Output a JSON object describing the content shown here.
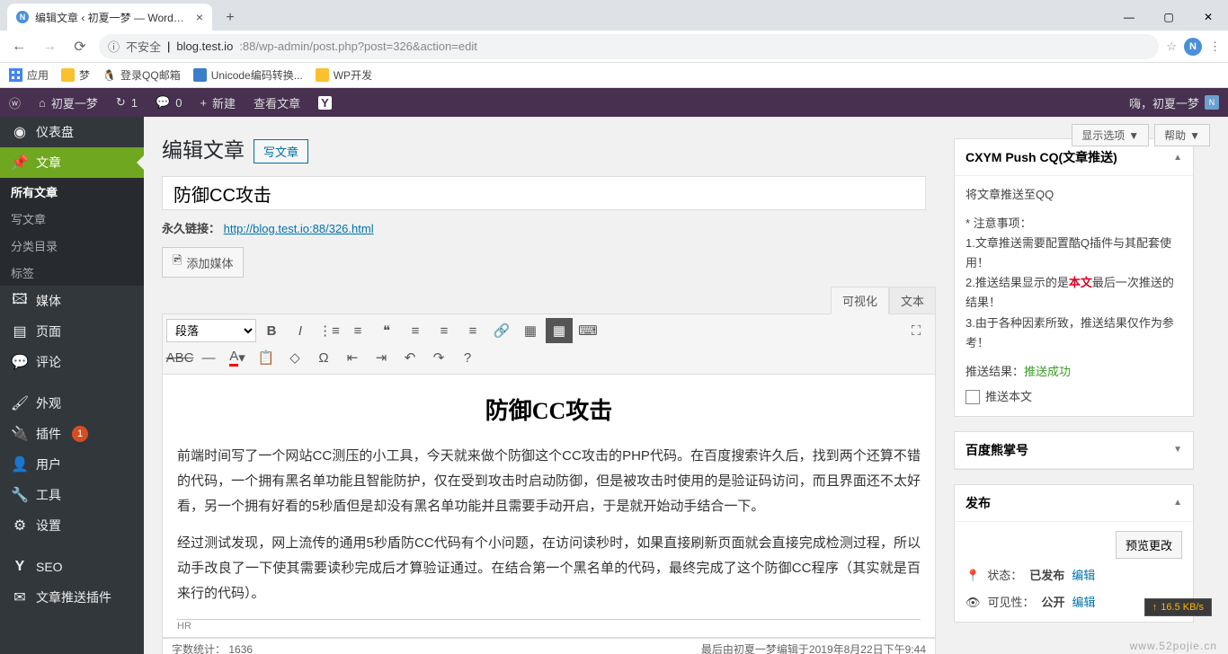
{
  "browser": {
    "tab_title": "编辑文章 ‹ 初夏一梦 — WordPr…",
    "insecure_label": "不安全",
    "url_host": "blog.test.io",
    "url_path": ":88/wp-admin/post.php?post=326&action=edit",
    "profile_letter": "N",
    "tab_icon_letter": "N"
  },
  "bookmarks": {
    "apps": "应用",
    "items": [
      "梦",
      "登录QQ邮箱",
      "Unicode编码转换...",
      "WP开发"
    ]
  },
  "adminbar": {
    "site_name": "初夏一梦",
    "refresh_count": "1",
    "comments_count": "0",
    "new_label": "新建",
    "view_post": "查看文章",
    "greeting": "嗨，初夏一梦"
  },
  "sidebar": {
    "dashboard": "仪表盘",
    "posts": "文章",
    "all_posts": "所有文章",
    "new_post": "写文章",
    "categories": "分类目录",
    "tags": "标签",
    "media": "媒体",
    "pages": "页面",
    "comments": "评论",
    "appearance": "外观",
    "plugins": "插件",
    "plugins_badge": "1",
    "users": "用户",
    "tools": "工具",
    "settings": "设置",
    "seo": "SEO",
    "push_plugin": "文章推送插件"
  },
  "screen": {
    "options": "显示选项",
    "help": "帮助"
  },
  "page": {
    "heading": "编辑文章",
    "add_new": "写文章",
    "title_value": "防御CC攻击",
    "permalink_label": "永久链接：",
    "permalink_url": "http://blog.test.io:88/326.html",
    "add_media": "添加媒体",
    "tab_visual": "可视化",
    "tab_text": "文本",
    "format_selector": "段落"
  },
  "article": {
    "heading": "防御CC攻击",
    "p1": "前端时间写了一个网站CC测压的小工具，今天就来做个防御这个CC攻击的PHP代码。在百度搜索许久后，找到两个还算不错的代码，一个拥有黑名单功能且智能防护，仅在受到攻击时启动防御，但是被攻击时使用的是验证码访问，而且界面还不太好看，另一个拥有好看的5秒盾但是却没有黑名单功能并且需要手动开启，于是就开始动手结合一下。",
    "p2": "经过测试发现，网上流传的通用5秒盾防CC代码有个小问题，在访问读秒时，如果直接刷新页面就会直接完成检测过程，所以动手改良了一下使其需要读秒完成后才算验证通过。在结合第一个黑名单的代码，最终完成了这个防御CC程序（其实就是百来行的代码）。",
    "hr_label": "HR",
    "word_count_label": "字数统计：",
    "word_count": "1636",
    "last_edit": "最后由初夏一梦编辑于2019年8月22日下午9:44"
  },
  "push_box": {
    "title": "CXYM Push CQ(文章推送)",
    "line1": "将文章推送至QQ",
    "notice_label": "* 注意事项：",
    "notice1": "1.文章推送需要配置酷Q插件与其配套使用！",
    "notice2a": "2.推送结果显示的是",
    "notice2b": "本文",
    "notice2c": "最后一次推送的结果！",
    "notice3": "3.由于各种因素所致，推送结果仅作为参考！",
    "result_label": "推送结果：",
    "result_value": "推送成功",
    "checkbox_label": "推送本文"
  },
  "baidu_box": {
    "title": "百度熊掌号"
  },
  "publish_box": {
    "title": "发布",
    "preview": "预览更改",
    "status_label": "状态：",
    "status_value": "已发布",
    "edit": "编辑",
    "visibility_label": "可见性：",
    "visibility_value": "公开"
  },
  "speed_overlay": "16.5 KB/s",
  "watermark": "www.52pojie.cn"
}
